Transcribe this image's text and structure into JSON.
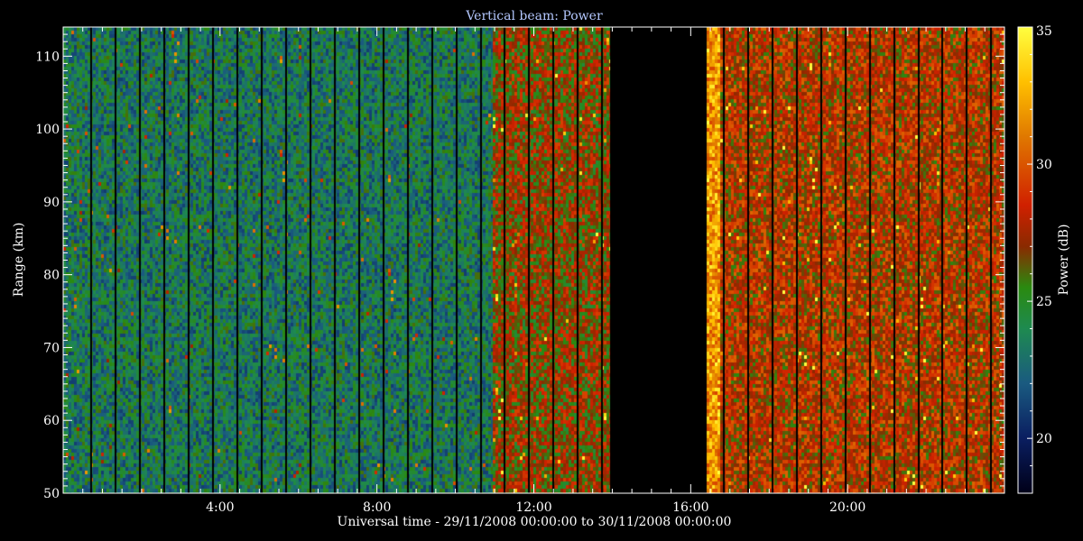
{
  "chart_data": {
    "type": "heatmap",
    "title": "Vertical beam: Power",
    "xlabel": "Universal time - 29/11/2008 00:00:00 to 30/11/2008 00:00:00",
    "ylabel": "Range (km)",
    "colorbar_label": "Power (dB)",
    "xlim": [
      0,
      24
    ],
    "ylim": [
      50,
      114
    ],
    "clim": [
      18,
      35
    ],
    "x_ticks": [
      {
        "value": 4,
        "label": "4:00"
      },
      {
        "value": 8,
        "label": "8:00"
      },
      {
        "value": 12,
        "label": "12:00"
      },
      {
        "value": 16,
        "label": "16:00"
      },
      {
        "value": 20,
        "label": "20:00"
      }
    ],
    "y_ticks": [
      50,
      60,
      70,
      80,
      90,
      100,
      110
    ],
    "colorbar_ticks": [
      20,
      25,
      30,
      35
    ],
    "no_data_intervals_hours": [
      [
        13.95,
        16.4
      ]
    ],
    "segments_hours": [
      {
        "start": 0.0,
        "end": 10.95,
        "mean_power_db": 23.5
      },
      {
        "start": 10.95,
        "end": 13.95,
        "mean_power_db": 27.0
      },
      {
        "start": 16.4,
        "end": 16.75,
        "mean_power_db": 32.0
      },
      {
        "start": 16.75,
        "end": 24.0,
        "mean_power_db": 28.0
      }
    ],
    "colormap": [
      {
        "value": 18,
        "color": "#000018"
      },
      {
        "value": 20,
        "color": "#0a1e60"
      },
      {
        "value": 22,
        "color": "#1a5a80"
      },
      {
        "value": 24,
        "color": "#1e8a50"
      },
      {
        "value": 25.5,
        "color": "#2a8a10"
      },
      {
        "value": 27,
        "color": "#8a2a00"
      },
      {
        "value": 28.5,
        "color": "#d02000"
      },
      {
        "value": 31,
        "color": "#e07800"
      },
      {
        "value": 33,
        "color": "#ffc000"
      },
      {
        "value": 35,
        "color": "#ffff40"
      }
    ]
  }
}
